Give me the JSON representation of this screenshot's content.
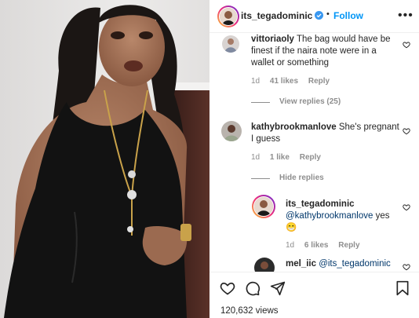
{
  "header": {
    "username": "its_tegadominic",
    "follow_label": "Follow",
    "dot": "•",
    "more_label": "•••"
  },
  "comments": [
    {
      "username": "vittoriaoly",
      "text_lines": [
        "The bag would have be",
        "finest if the naira note were in a",
        "wallet or something"
      ],
      "time": "1d",
      "likes": "41 likes",
      "reply": "Reply",
      "view_replies": "View replies (25)"
    },
    {
      "username": "kathybrookmanlove",
      "text_lines": [
        "She's pregnant",
        "I guess"
      ],
      "time": "1d",
      "likes": "1 like",
      "reply": "Reply",
      "hide_replies": "Hide replies"
    },
    {
      "username": "its_tegadominic",
      "mention": "@kathybrookmanlove",
      "text": "yes",
      "emoji": "😁",
      "time": "1d",
      "likes": "6 likes",
      "reply": "Reply"
    },
    {
      "username": "mel_iic",
      "mention": "@its_tegadominic"
    }
  ],
  "footer": {
    "views": "120,632 views"
  },
  "icons": {
    "like": "heart-icon",
    "comment": "comment-bubble-icon",
    "share": "paper-plane-icon",
    "save": "bookmark-icon",
    "verified": "verified-badge-icon"
  },
  "colors": {
    "link": "#0095f6",
    "mention": "#00376b",
    "muted": "#8e8e8e",
    "text": "#262626"
  }
}
